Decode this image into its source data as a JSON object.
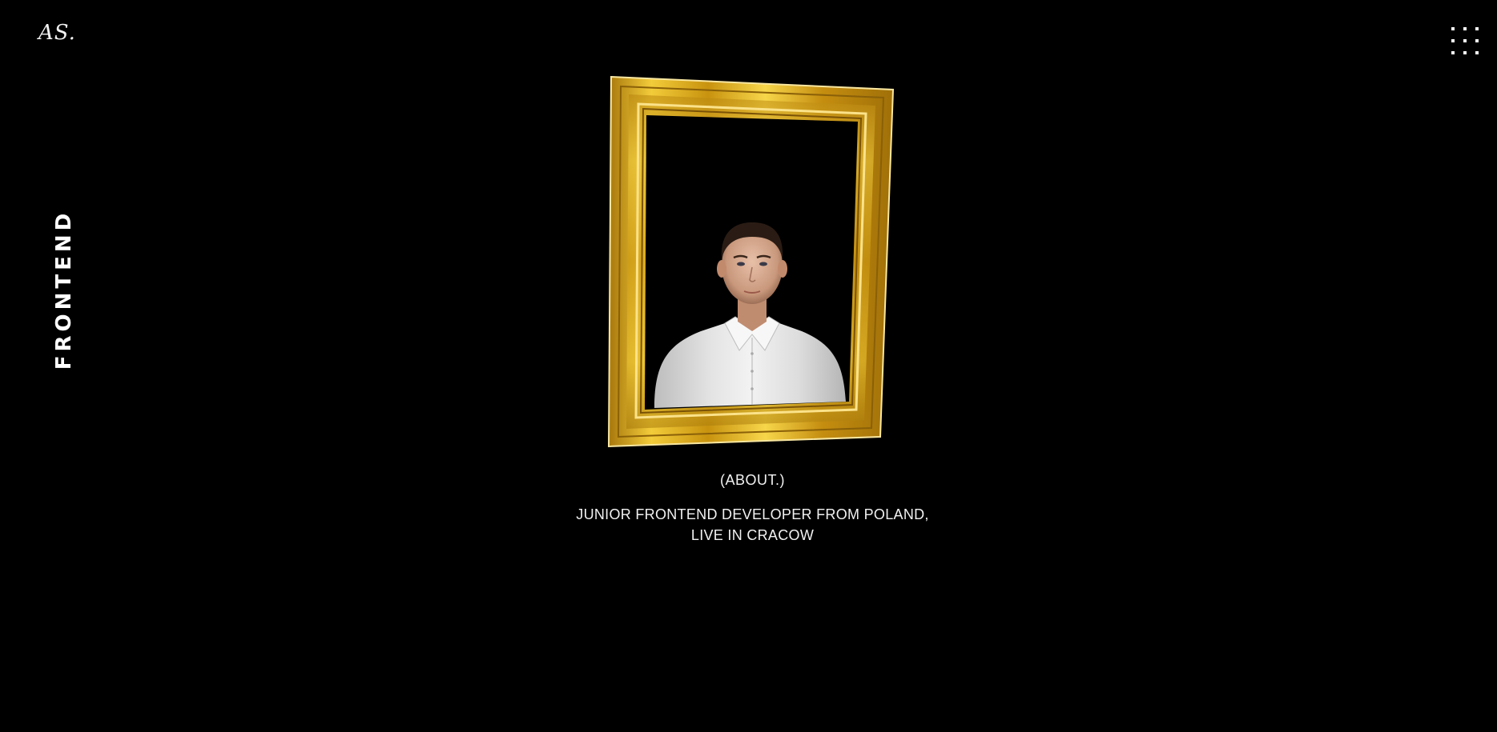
{
  "header": {
    "logo": "AS.",
    "menu_icon": "grid-dots-icon"
  },
  "side": {
    "label": "FRONTEND"
  },
  "portrait": {
    "frame_color": "#d8a71a",
    "description": "portrait-in-gold-frame"
  },
  "about": {
    "heading": "(ABOUT.)",
    "line1": "JUNIOR FRONTEND DEVELOPER FROM POLAND,",
    "line2": "LIVE IN CRACOW"
  }
}
